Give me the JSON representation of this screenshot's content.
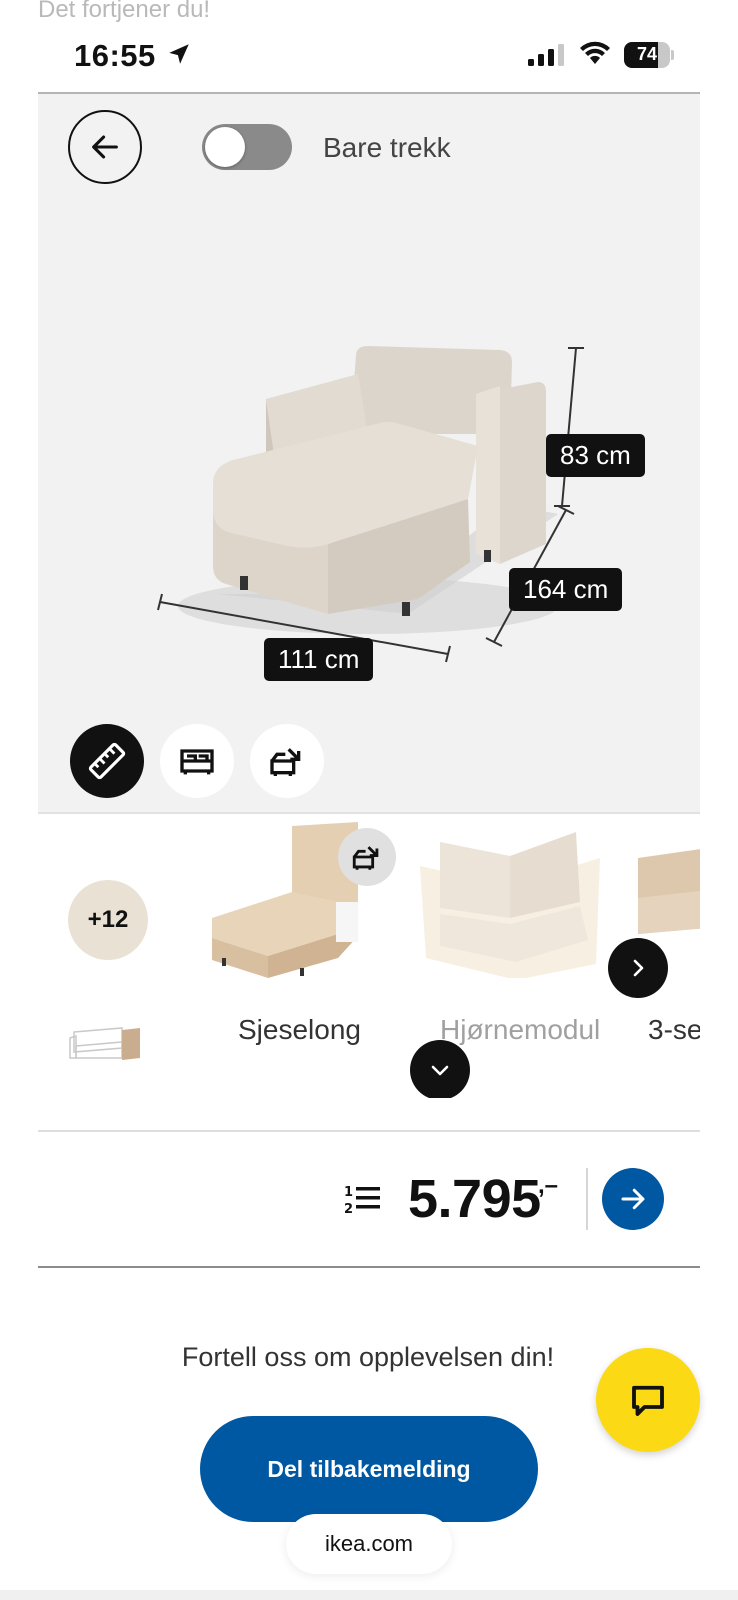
{
  "top_banner": {
    "text": "Det fortjener du!"
  },
  "status_bar": {
    "time": "16:55",
    "battery_percent": "74",
    "battery_level": 0.74,
    "icons": [
      "location-arrow-icon",
      "cellular-signal-icon",
      "wifi-icon",
      "battery-icon"
    ]
  },
  "viewer": {
    "toggle_label": "Bare trekk",
    "toggle_on": false,
    "dimensions": {
      "height": "83 cm",
      "depth": "164 cm",
      "width": "111 cm"
    },
    "view_modes": [
      "measure",
      "bed",
      "storage"
    ],
    "active_view_mode": "measure"
  },
  "carousel": {
    "more_badge": "+12",
    "modules": [
      {
        "label": "Sjeselong",
        "selected": true
      },
      {
        "label": "Hjørnemodul",
        "selected": false
      },
      {
        "label": "3-se",
        "selected": false
      }
    ]
  },
  "price": {
    "amount": "5.795",
    "suffix": ",–"
  },
  "feedback": {
    "prompt": "Fortell oss om opplevelsen din!",
    "button_label": "Del tilbakemelding"
  },
  "browser": {
    "url": "ikea.com"
  },
  "colors": {
    "brand_blue": "#0058a3",
    "chat_yellow": "#fbd914",
    "beige": "#e8d8c2",
    "viewer_bg": "#f2f2f2"
  }
}
